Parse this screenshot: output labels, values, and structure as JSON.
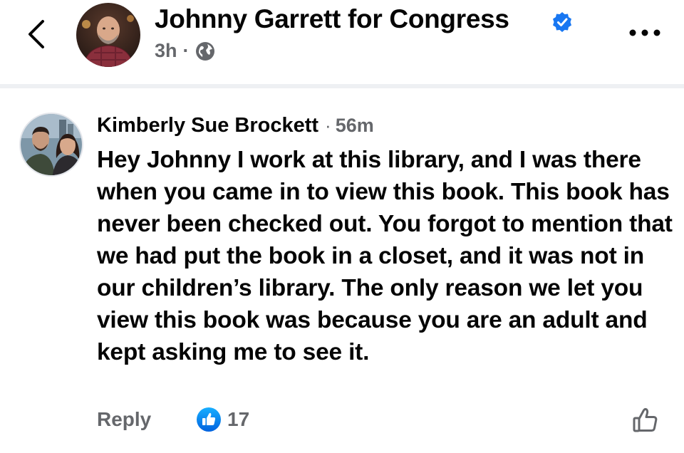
{
  "header": {
    "page_name": "Johnny Garrett for Congress",
    "post_time": "3h",
    "separator": "·",
    "audience_icon": "globe-icon",
    "verified_icon": "verified-badge-icon",
    "back_icon": "chevron-left-icon",
    "more_icon": "more-horizontal-icon"
  },
  "comment": {
    "author": "Kimberly Sue Brockett",
    "separator": "·",
    "time": "56m",
    "text": "Hey Johnny I work at this library, and I was there when you came in to view this book. This book has never been checked out. You forgot to mention that we had put the book in a closet, and it was not in our children’s library. The only reason we let you view this book was because you are an adult and kept asking me to see it."
  },
  "actions": {
    "reply_label": "Reply",
    "like_count": "17",
    "like_badge_icon": "thumbs-up-badge-icon",
    "like_button_icon": "thumbs-up-outline-icon"
  },
  "colors": {
    "brand_blue": "#1877f2",
    "secondary_text": "#65676b",
    "primary_text": "#050505",
    "divider": "#eef0f3"
  }
}
